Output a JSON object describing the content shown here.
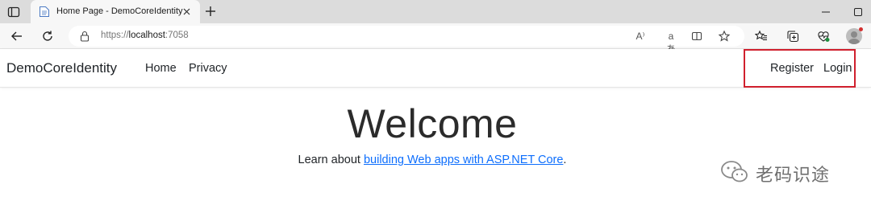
{
  "browser": {
    "tab": {
      "title": "Home Page - DemoCoreIdentity"
    },
    "address": {
      "scheme": "https://",
      "host": "localhost",
      "port": ":7058"
    },
    "omnibox_icons": {
      "read_aloud": "A⁾",
      "translate": "aあ"
    }
  },
  "site": {
    "brand": "DemoCoreIdentity",
    "nav": {
      "home": "Home",
      "privacy": "Privacy",
      "register": "Register",
      "login": "Login"
    },
    "highlight_color": "#d0202e"
  },
  "main": {
    "heading": "Welcome",
    "learn_prefix": "Learn about ",
    "learn_link": "building Web apps with ASP.NET Core",
    "learn_suffix": "."
  },
  "watermark": {
    "text": "老码识途"
  },
  "colors": {
    "link": "#0d6efd",
    "tabstrip": "#dcdcdc",
    "toolbar": "#f7f7f7"
  }
}
